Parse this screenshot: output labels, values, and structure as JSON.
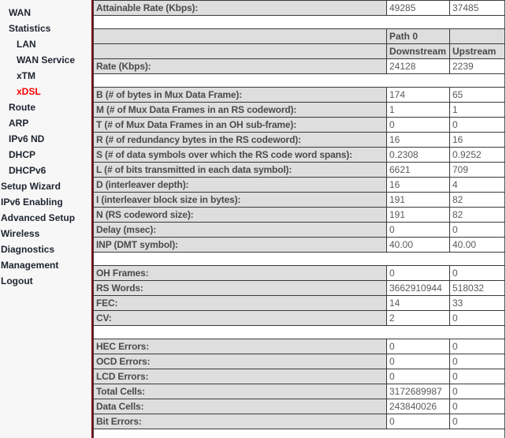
{
  "sidebar": {
    "items": [
      {
        "label": "WAN",
        "level": 1,
        "active": false
      },
      {
        "label": "Statistics",
        "level": 1,
        "active": false
      },
      {
        "label": "LAN",
        "level": 2,
        "active": false
      },
      {
        "label": "WAN Service",
        "level": 2,
        "active": false
      },
      {
        "label": "xTM",
        "level": 2,
        "active": false
      },
      {
        "label": "xDSL",
        "level": 2,
        "active": true
      },
      {
        "label": "Route",
        "level": 1,
        "active": false
      },
      {
        "label": "ARP",
        "level": 1,
        "active": false
      },
      {
        "label": "IPv6 ND",
        "level": 1,
        "active": false
      },
      {
        "label": "DHCP",
        "level": 1,
        "active": false
      },
      {
        "label": "DHCPv6",
        "level": 1,
        "active": false
      },
      {
        "label": "Setup Wizard",
        "level": 0,
        "active": false
      },
      {
        "label": "IPv6 Enabling",
        "level": 0,
        "active": false
      },
      {
        "label": "Advanced Setup",
        "level": 0,
        "active": false
      },
      {
        "label": "Wireless",
        "level": 0,
        "active": false
      },
      {
        "label": "Diagnostics",
        "level": 0,
        "active": false
      },
      {
        "label": "Management",
        "level": 0,
        "active": false
      },
      {
        "label": "Logout",
        "level": 0,
        "active": false
      }
    ]
  },
  "stats": {
    "attainable": {
      "label": "Attainable Rate (Kbps):",
      "downstream": "49285",
      "upstream": "37485"
    },
    "path_header": {
      "path": "Path 0",
      "downstream": "Downstream",
      "upstream": "Upstream"
    },
    "rate": {
      "label": "Rate (Kbps):",
      "downstream": "24128",
      "upstream": "2239"
    },
    "params": [
      {
        "label": "B (# of bytes in Mux Data Frame):",
        "downstream": "174",
        "upstream": "65"
      },
      {
        "label": "M (# of Mux Data Frames in an RS codeword):",
        "downstream": "1",
        "upstream": "1"
      },
      {
        "label": "T (# of Mux Data Frames in an OH sub-frame):",
        "downstream": "0",
        "upstream": "0"
      },
      {
        "label": "R (# of redundancy bytes in the RS codeword):",
        "downstream": "16",
        "upstream": "16"
      },
      {
        "label": "S (# of data symbols over which the RS code word spans):",
        "downstream": "0.2308",
        "upstream": "0.9252"
      },
      {
        "label": "L (# of bits transmitted in each data symbol):",
        "downstream": "6621",
        "upstream": "709"
      },
      {
        "label": "D (interleaver depth):",
        "downstream": "16",
        "upstream": "4"
      },
      {
        "label": "I (interleaver block size in bytes):",
        "downstream": "191",
        "upstream": "82"
      },
      {
        "label": "N (RS codeword size):",
        "downstream": "191",
        "upstream": "82"
      },
      {
        "label": "Delay (msec):",
        "downstream": "0",
        "upstream": "0"
      },
      {
        "label": "INP (DMT symbol):",
        "downstream": "40.00",
        "upstream": "40.00"
      }
    ],
    "counters": [
      {
        "label": "OH Frames:",
        "downstream": "0",
        "upstream": "0"
      },
      {
        "label": "RS Words:",
        "downstream": "3662910944",
        "upstream": "518032"
      },
      {
        "label": "FEC:",
        "downstream": "14",
        "upstream": "33"
      },
      {
        "label": "CV:",
        "downstream": "2",
        "upstream": "0"
      }
    ],
    "errors": [
      {
        "label": "HEC Errors:",
        "downstream": "0",
        "upstream": "0"
      },
      {
        "label": "OCD Errors:",
        "downstream": "0",
        "upstream": "0"
      },
      {
        "label": "LCD Errors:",
        "downstream": "0",
        "upstream": "0"
      },
      {
        "label": "Total Cells:",
        "downstream": "3172689987",
        "upstream": "0"
      },
      {
        "label": "Data Cells:",
        "downstream": "243840026",
        "upstream": "0"
      },
      {
        "label": "Bit Errors:",
        "downstream": "0",
        "upstream": "0"
      }
    ]
  },
  "colors": {
    "accent": "#7d0a18",
    "active_link": "#ff0000",
    "label_bg": "#dedede",
    "label_text": "#4a4a4a",
    "value_text": "#5a5a60",
    "nav_text": "#1d2430"
  }
}
